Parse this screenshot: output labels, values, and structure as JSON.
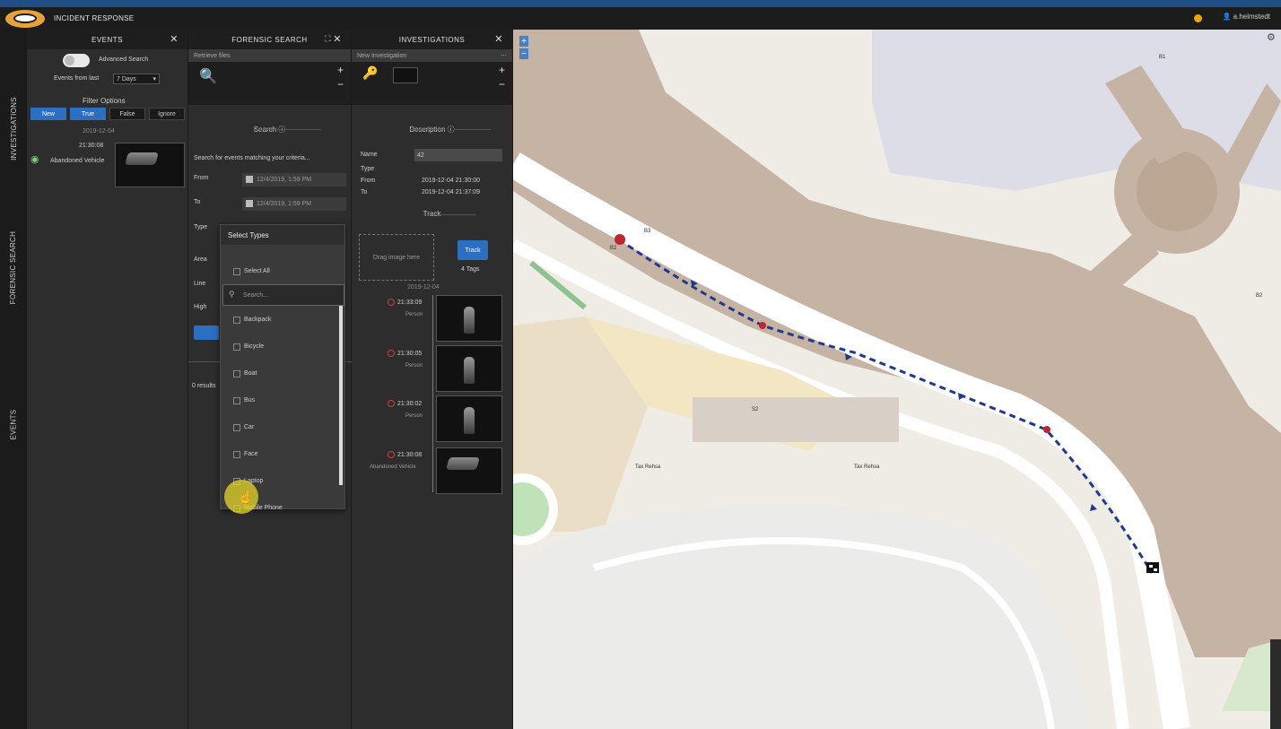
{
  "app": {
    "title": "INCIDENT RESPONSE",
    "user": "a.helmstedt"
  },
  "nav": {
    "tabs": [
      "INVESTIGATIONS",
      "FORENSIC SEARCH",
      "EVENTS"
    ]
  },
  "events": {
    "title": "EVENTS",
    "advanced_search": "Advanced Search",
    "events_from_last_label": "Events from last",
    "events_from_last_value": "7 Days",
    "filter_options": "Filter Options",
    "filters": [
      "New",
      "True",
      "False",
      "Ignore"
    ],
    "date": "2019-12-04",
    "item_time": "21:30:08",
    "item_label": "Abandoned Vehicle"
  },
  "forensic": {
    "title": "FORENSIC SEARCH",
    "subtitle": "Retrieve files",
    "search_section": "Search",
    "hint": "Search for events matching your criteria...",
    "from_label": "From",
    "from_value": "12/4/2019, 1:59 PM",
    "to_label": "To",
    "to_value": "12/4/2019, 1:59 PM",
    "type_label": "Type",
    "area_label": "Area",
    "line_label": "Line",
    "high_label": "High",
    "results": "0 results"
  },
  "dropdown": {
    "header": "Select Types",
    "select_all": "Select All",
    "search_placeholder": "Search...",
    "options": [
      "Backpack",
      "Bicycle",
      "Boat",
      "Bus",
      "Car",
      "Face",
      "Laptop",
      "Mobile Phone"
    ]
  },
  "investigations": {
    "title": "INVESTIGATIONS",
    "subtitle": "New Investigation",
    "description_section": "Description",
    "name_label": "Name",
    "name_value": "42",
    "type_label": "Type",
    "from_label": "From",
    "from_value": "2019-12-04 21:30:00",
    "to_label": "To",
    "to_value": "2019-12-04 21:37:09",
    "track_section": "Track",
    "drop_label": "Drag image here",
    "track_button": "Track",
    "tags": "4 Tags",
    "track_date": "2019-12-04",
    "entries": [
      {
        "time": "21:33:09",
        "label": "Person"
      },
      {
        "time": "21:30:05",
        "label": "Person"
      },
      {
        "time": "21:30:02",
        "label": "Person"
      },
      {
        "time": "21:30:08",
        "label": "Abandoned Vehicle"
      }
    ]
  },
  "map": {
    "labels": [
      "B2",
      "B3",
      "B1",
      "B2",
      "S2",
      "Tax Rehsa",
      "Tax Rehsa"
    ],
    "route_color": "#1f3b8f",
    "marker_color": "#c0262d"
  }
}
